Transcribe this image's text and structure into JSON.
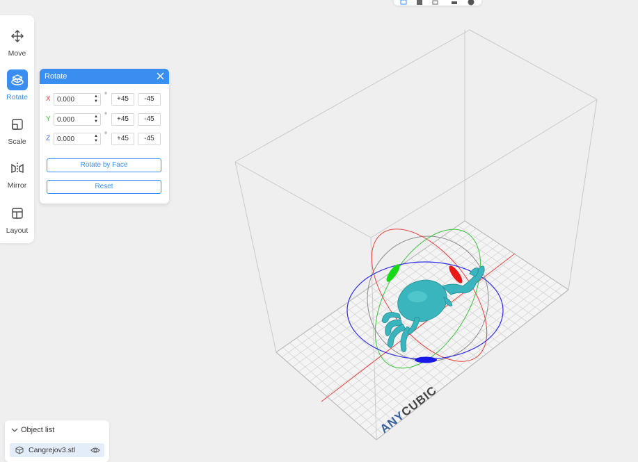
{
  "toolbar": {
    "items": [
      {
        "label": "Move",
        "icon": "move-icon"
      },
      {
        "label": "Rotate",
        "icon": "rotate-icon",
        "active": true
      },
      {
        "label": "Scale",
        "icon": "scale-icon"
      },
      {
        "label": "Mirror",
        "icon": "mirror-icon"
      },
      {
        "label": "Layout",
        "icon": "layout-icon"
      }
    ]
  },
  "rotate_panel": {
    "title": "Rotate",
    "axes": [
      {
        "axis": "X",
        "value": "0.000",
        "color": "#e8413c"
      },
      {
        "axis": "Y",
        "value": "0.000",
        "color": "#3cc23c"
      },
      {
        "axis": "Z",
        "value": "0.000",
        "color": "#3a6ee8"
      }
    ],
    "degree_symbol": "°",
    "plus_label": "+45",
    "minus_label": "-45",
    "rotate_by_face_label": "Rotate by Face",
    "reset_label": "Reset"
  },
  "object_list": {
    "title": "Object list",
    "items": [
      {
        "name": "Cangrejov3.stl"
      }
    ]
  },
  "viewport": {
    "bed_logo_part1": "ANY",
    "bed_logo_part2": "CUBIC",
    "model_color": "#3bb5bd",
    "accent_color": "#3a8ef0"
  }
}
